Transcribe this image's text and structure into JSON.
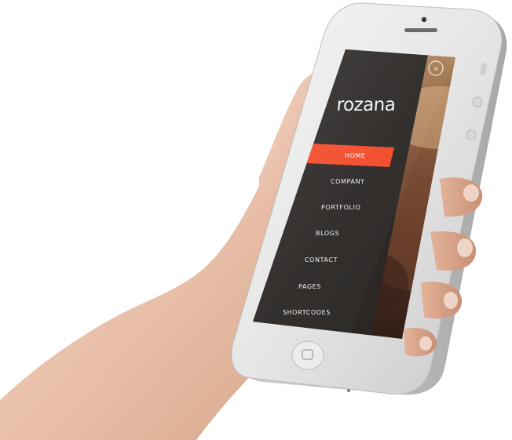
{
  "app": {
    "logo_text": "rozana",
    "accent_color": "#f24a28",
    "close_icon": "close-icon"
  },
  "menu": {
    "items": [
      {
        "label": "HOME",
        "active": true
      },
      {
        "label": "COMPANY",
        "active": false
      },
      {
        "label": "PORTFOLIO",
        "active": false
      },
      {
        "label": "BLOGS",
        "active": false
      },
      {
        "label": "CONTACT",
        "active": false
      },
      {
        "label": "PAGES",
        "active": false
      },
      {
        "label": "SHORTCODES",
        "active": false
      }
    ]
  }
}
